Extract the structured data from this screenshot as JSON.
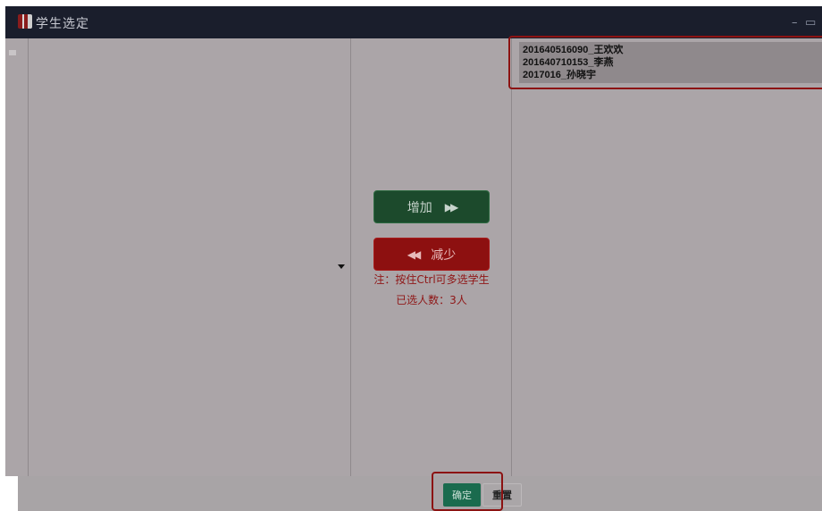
{
  "window": {
    "title": "学生选定",
    "minimize_glyph": "–",
    "restore_glyph": "▭"
  },
  "actions": {
    "add_label": "增加",
    "add_icon": "▶▶",
    "remove_label": "减少",
    "remove_icon": "◀◀"
  },
  "hint": {
    "note": "注：按住Ctrl可多选学生",
    "count": "已选人数：3人"
  },
  "selected": {
    "items": [
      "201640516090_王欢欢",
      "201640710153_李燕",
      "2017016_孙晓宇"
    ]
  },
  "footer": {
    "ok_label": "确定",
    "reset_label": "重置"
  },
  "colors": {
    "add_button": "#1c4a2c",
    "remove_button": "#8d1010",
    "ok_button": "#1a6b4e",
    "highlight": "#8c1212"
  }
}
